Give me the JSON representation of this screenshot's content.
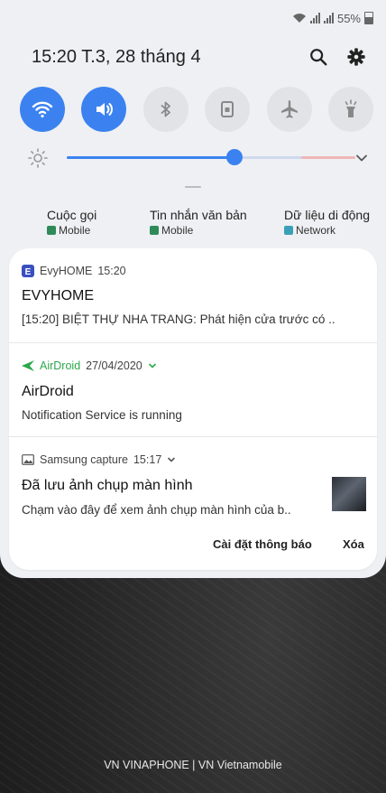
{
  "status_bar": {
    "battery": "55%"
  },
  "header": {
    "time_date": "15:20  T.3, 28 tháng 4"
  },
  "quick_settings": [
    {
      "name": "wifi",
      "active": true
    },
    {
      "name": "sound",
      "active": true
    },
    {
      "name": "bluetooth",
      "active": false
    },
    {
      "name": "screen-rotation",
      "active": false
    },
    {
      "name": "airplane-mode",
      "active": false
    },
    {
      "name": "flashlight",
      "active": false
    }
  ],
  "brightness": {
    "level_fraction": 0.58
  },
  "sims": [
    {
      "title": "Cuộc gọi",
      "sub": "Mobile"
    },
    {
      "title": "Tin nhắn văn bản",
      "sub": "Mobile"
    },
    {
      "title": "Dữ liệu di động",
      "sub": "Network"
    }
  ],
  "notifications": [
    {
      "app": "EvyHOME",
      "time": "15:20",
      "title": "EVYHOME",
      "body": "[15:20] BIỆT THỰ NHA TRANG: Phát hiện cửa trước có .."
    },
    {
      "app": "AirDroid",
      "time": "27/04/2020",
      "title": "AirDroid",
      "body": "Notification Service is running"
    },
    {
      "app": "Samsung capture",
      "time": "15:17",
      "title": "Đã lưu ảnh chụp màn hình",
      "body": "Chạm vào đây để xem ảnh chụp màn hình của b.."
    }
  ],
  "actions": {
    "settings": "Cài đặt thông báo",
    "clear": "Xóa"
  },
  "carrier": "VN VINAPHONE | VN Vietnamobile",
  "colors": {
    "accent": "#3b82f0",
    "airdroid": "#2aa84a",
    "evyhome": "#3a4fbf"
  }
}
